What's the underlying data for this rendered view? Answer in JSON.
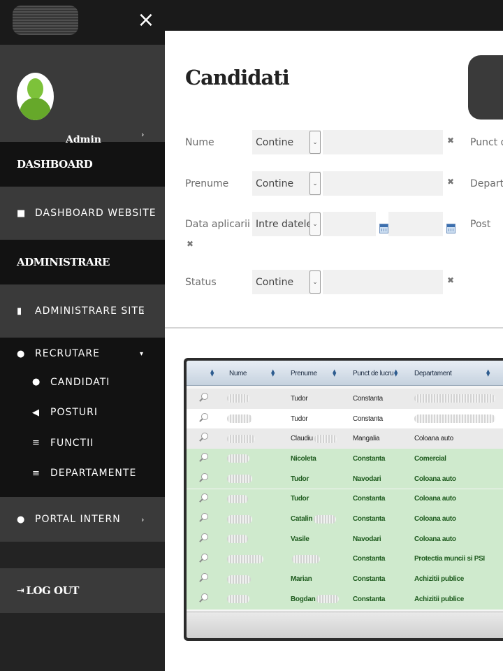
{
  "sidebar": {
    "user_name": "Admin",
    "section_dashboard": "DASHBOARD",
    "dashboard_website": "DASHBOARD WEBSITE",
    "section_admin": "ADMINISTRARE",
    "administrare_site": "ADMINISTRARE SITE",
    "recrutare": "RECRUTARE",
    "sub_items": [
      {
        "label": "CANDIDATI",
        "icon": "user-icon"
      },
      {
        "label": "POSTURI",
        "icon": "bullhorn-icon"
      },
      {
        "label": "FUNCTII",
        "icon": "list-icon"
      },
      {
        "label": "DEPARTAMENTE",
        "icon": "list-icon"
      }
    ],
    "portal_intern": "PORTAL INTERN",
    "logout": "LOG OUT"
  },
  "page": {
    "title": "Candidati"
  },
  "filters": {
    "nume_label": "Nume",
    "prenume_label": "Prenume",
    "data_label": "Data aplicarii",
    "status_label": "Status",
    "op_contine": "Contine",
    "op_intre": "Intre datele",
    "right_label_1": "Punct d",
    "right_label_2": "Departa",
    "right_label_3": "Post"
  },
  "grid": {
    "columns": [
      "Nume",
      "Prenume",
      "Punct de lucru",
      "Departament"
    ],
    "rows": [
      {
        "style": "grey",
        "prenume": "Tudor",
        "punct": "Constanta",
        "departament": ""
      },
      {
        "style": "white",
        "prenume": "Tudor",
        "punct": "Constanta",
        "departament": ""
      },
      {
        "style": "grey",
        "prenume": "Claudiu",
        "punct": "Mangalia",
        "departament": "Coloana auto"
      },
      {
        "style": "green",
        "prenume": "Nicoleta",
        "punct": "Constanta",
        "departament": "Comercial"
      },
      {
        "style": "green",
        "prenume": "Tudor",
        "punct": "Navodari",
        "departament": "Coloana auto"
      },
      {
        "style": "green",
        "prenume": "Tudor",
        "punct": "Constanta",
        "departament": "Coloana auto"
      },
      {
        "style": "green",
        "prenume": "Catalin",
        "punct": "Constanta",
        "departament": "Coloana auto"
      },
      {
        "style": "green",
        "prenume": "Vasile",
        "punct": "Navodari",
        "departament": "Coloana auto"
      },
      {
        "style": "green",
        "prenume": "",
        "punct": "Constanta",
        "departament": "Protectia muncii si PSI"
      },
      {
        "style": "green",
        "prenume": "Marian",
        "punct": "Constanta",
        "departament": "Achizitii publice"
      },
      {
        "style": "green",
        "prenume": "Bogdan",
        "punct": "Constanta",
        "departament": "Achizitii publice"
      }
    ]
  }
}
